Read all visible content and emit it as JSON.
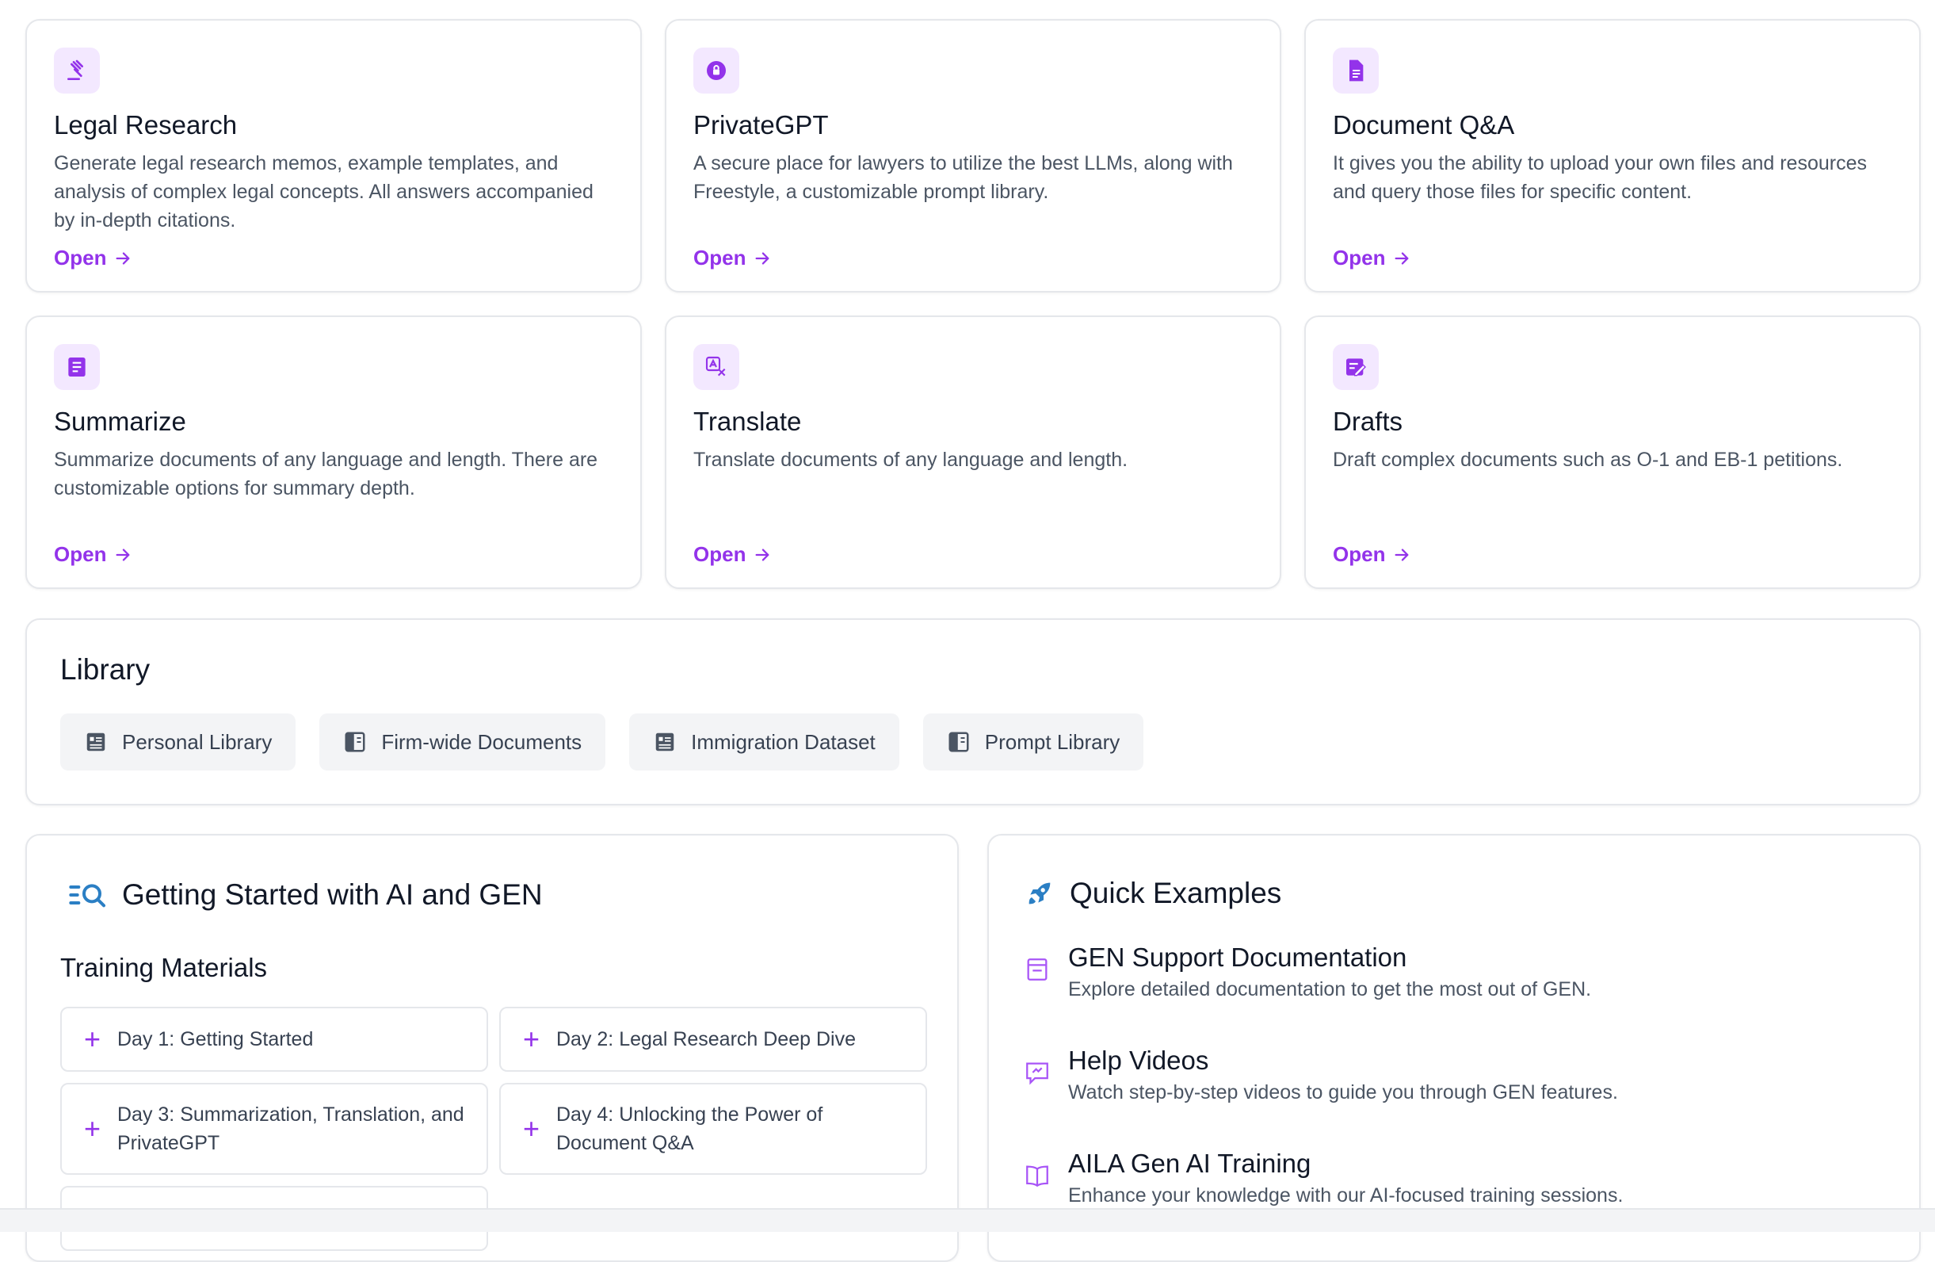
{
  "tools": [
    {
      "icon": "gavel-icon",
      "title": "Legal Research",
      "description": "Generate legal research memos, example templates, and analysis of complex legal concepts. All answers accompanied by in-depth citations.",
      "link": "Open"
    },
    {
      "icon": "lock-chat-icon",
      "title": "PrivateGPT",
      "description": "A secure place for lawyers to utilize the best LLMs, along with Freestyle, a customizable prompt library.",
      "link": "Open"
    },
    {
      "icon": "document-icon",
      "title": "Document Q&A",
      "description": "It gives you the ability to upload your own files and resources and query those files for specific content.",
      "link": "Open"
    },
    {
      "icon": "summary-icon",
      "title": "Summarize",
      "description": "Summarize documents of any language and length. There are customizable options for summary depth.",
      "link": "Open"
    },
    {
      "icon": "translate-icon",
      "title": "Translate",
      "description": "Translate documents of any language and length.",
      "link": "Open"
    },
    {
      "icon": "edit-note-icon",
      "title": "Drafts",
      "description": "Draft complex documents such as O-1 and EB-1 petitions.",
      "link": "Open"
    }
  ],
  "library": {
    "title": "Library",
    "buttons": [
      {
        "label": "Personal Library",
        "icon": "article-icon"
      },
      {
        "label": "Firm-wide Documents",
        "icon": "book-icon"
      },
      {
        "label": "Immigration Dataset",
        "icon": "article-icon"
      },
      {
        "label": "Prompt Library",
        "icon": "book-icon"
      }
    ]
  },
  "getting_started": {
    "title": "Getting Started with AI and GEN",
    "subtitle": "Training Materials",
    "items": [
      "Day 1: Getting Started",
      "Day 2: Legal Research Deep Dive",
      "Day 3: Summarization, Translation, and PrivateGPT",
      "Day 4: Unlocking the Power of Document Q&A",
      ""
    ]
  },
  "quick_examples": {
    "title": "Quick Examples",
    "items": [
      {
        "title": "GEN Support Documentation",
        "description": "Explore detailed documentation to get the most out of GEN.",
        "icon": "document-outline-icon"
      },
      {
        "title": "Help Videos",
        "description": "Watch step-by-step videos to guide you through GEN features.",
        "icon": "chat-outline-icon"
      },
      {
        "title": "AILA Gen AI Training",
        "description": "Enhance your knowledge with our AI-focused training sessions.",
        "icon": "open-book-icon"
      }
    ]
  },
  "colors": {
    "accent": "#9333ea",
    "accent_bg": "#f3e8ff",
    "blue": "#2b7fc4"
  }
}
